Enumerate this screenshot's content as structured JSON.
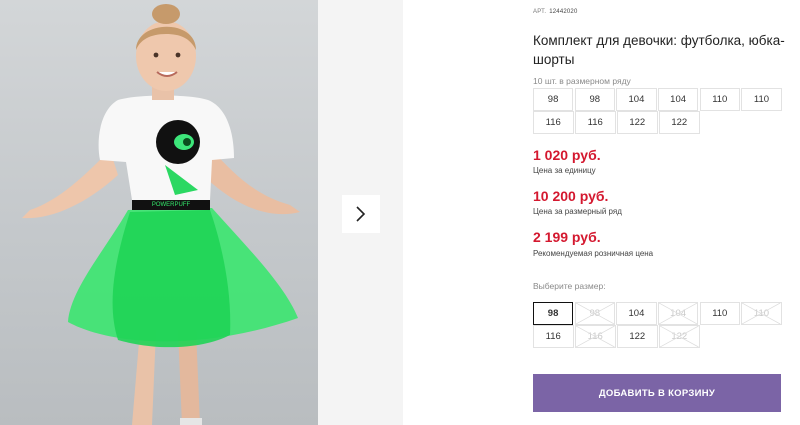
{
  "gallery": {
    "next_icon": "chevron-right-icon"
  },
  "product": {
    "article_label": "АРТ.",
    "article_number": "12442020",
    "title": "Комплект для девочки: футболка, юбка-шорты",
    "row_caption": "10 шт. в размерном ряду",
    "row_sizes": [
      [
        "98",
        "98",
        "104",
        "104",
        "110",
        "110"
      ],
      [
        "116",
        "116",
        "122",
        "122"
      ]
    ],
    "prices": [
      {
        "value": "1 020 руб.",
        "label": "Цена за единицу"
      },
      {
        "value": "10 200 руб.",
        "label": "Цена за размерный ряд"
      },
      {
        "value": "2 199 руб.",
        "label": "Рекомендуемая розничная цена"
      }
    ],
    "price_color": "#d4182f",
    "choose_caption": "Выберите размер:",
    "pick_sizes": [
      [
        {
          "size": "98",
          "state": "selected"
        },
        {
          "size": "98",
          "state": "disabled"
        },
        {
          "size": "104",
          "state": "available"
        },
        {
          "size": "104",
          "state": "disabled"
        },
        {
          "size": "110",
          "state": "available"
        },
        {
          "size": "110",
          "state": "disabled"
        }
      ],
      [
        {
          "size": "116",
          "state": "available"
        },
        {
          "size": "116",
          "state": "disabled"
        },
        {
          "size": "122",
          "state": "available"
        },
        {
          "size": "122",
          "state": "disabled"
        }
      ]
    ],
    "add_to_cart_label": "ДОБАВИТЬ В КОРЗИНУ",
    "button_color": "#7b64a6"
  }
}
